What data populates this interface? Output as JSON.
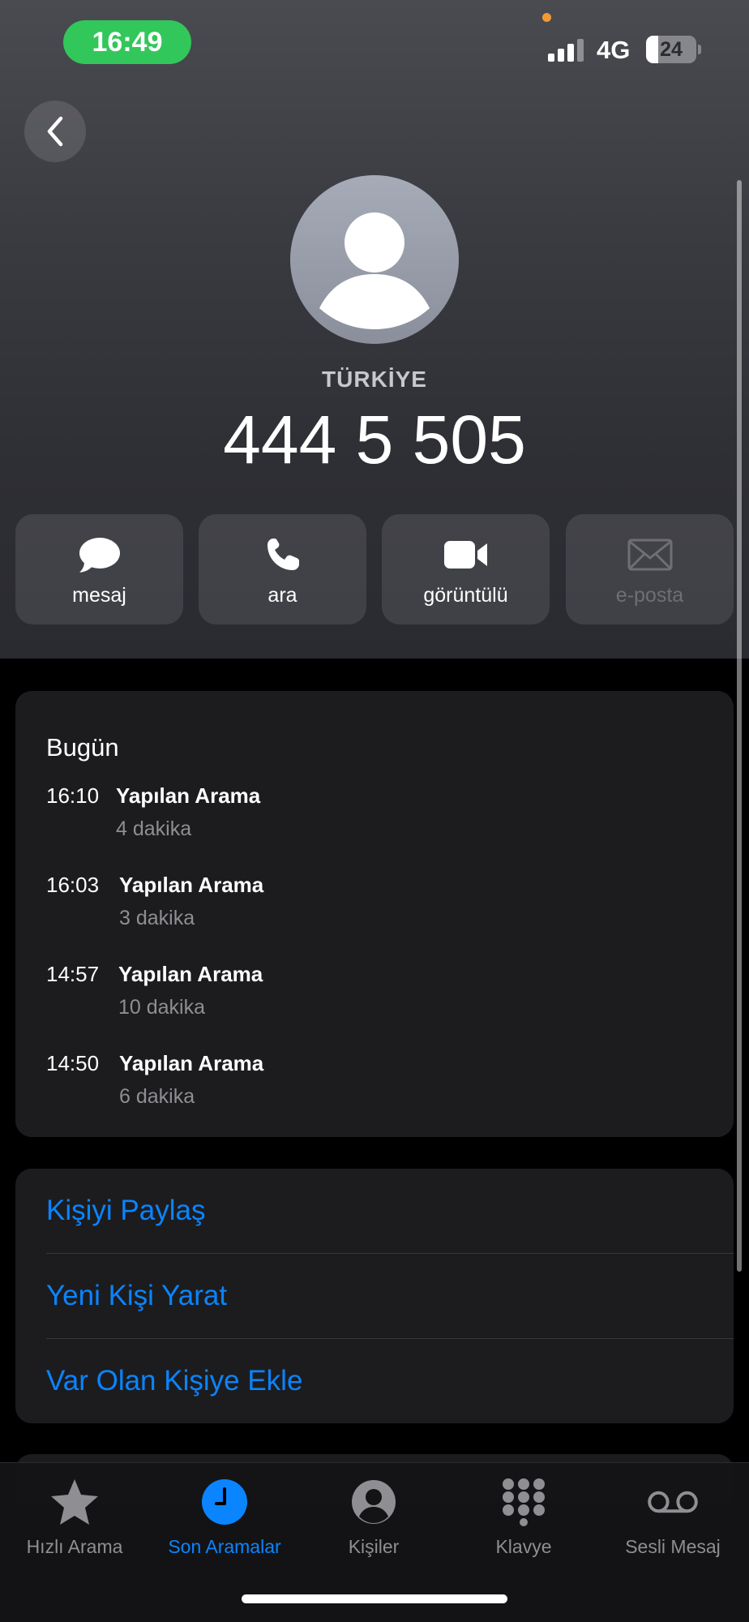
{
  "status_bar": {
    "time": "16:49",
    "network": "4G",
    "battery": "24",
    "battery_level": 0.24,
    "signal_bars": 4,
    "signal_bars_active": 3
  },
  "contact": {
    "country": "TÜRKİYE",
    "number": "444 5 505"
  },
  "actions": [
    {
      "label": "mesaj",
      "icon": "message-bubble-icon",
      "enabled": true
    },
    {
      "label": "ara",
      "icon": "phone-icon",
      "enabled": true
    },
    {
      "label": "görüntülü",
      "icon": "video-camera-icon",
      "enabled": true
    },
    {
      "label": "e-posta",
      "icon": "envelope-icon",
      "enabled": false
    }
  ],
  "history": {
    "title": "Bugün",
    "calls": [
      {
        "time": "16:10",
        "type": "Yapılan Arama",
        "duration": "4 dakika"
      },
      {
        "time": "16:03",
        "type": "Yapılan Arama",
        "duration": "3 dakika"
      },
      {
        "time": "14:57",
        "type": "Yapılan Arama",
        "duration": "10 dakika"
      },
      {
        "time": "14:50",
        "type": "Yapılan Arama",
        "duration": "6 dakika"
      }
    ]
  },
  "options": [
    {
      "label": "Kişiyi Paylaş"
    },
    {
      "label": "Yeni Kişi Yarat"
    },
    {
      "label": "Var Olan Kişiye Ekle"
    }
  ],
  "tabbar": {
    "items": [
      {
        "label": "Hızlı Arama",
        "icon": "star-icon",
        "active": false
      },
      {
        "label": "Son Aramalar",
        "icon": "clock-icon",
        "active": true
      },
      {
        "label": "Kişiler",
        "icon": "person-circle-icon",
        "active": false
      },
      {
        "label": "Klavye",
        "icon": "keypad-icon",
        "active": false
      },
      {
        "label": "Sesli Mesaj",
        "icon": "voicemail-icon",
        "active": false
      }
    ]
  },
  "colors": {
    "accent": "#0a84ff",
    "time_pill": "#32c75a",
    "card_bg": "#1c1c1e",
    "secondary_text": "#8e8e93"
  }
}
